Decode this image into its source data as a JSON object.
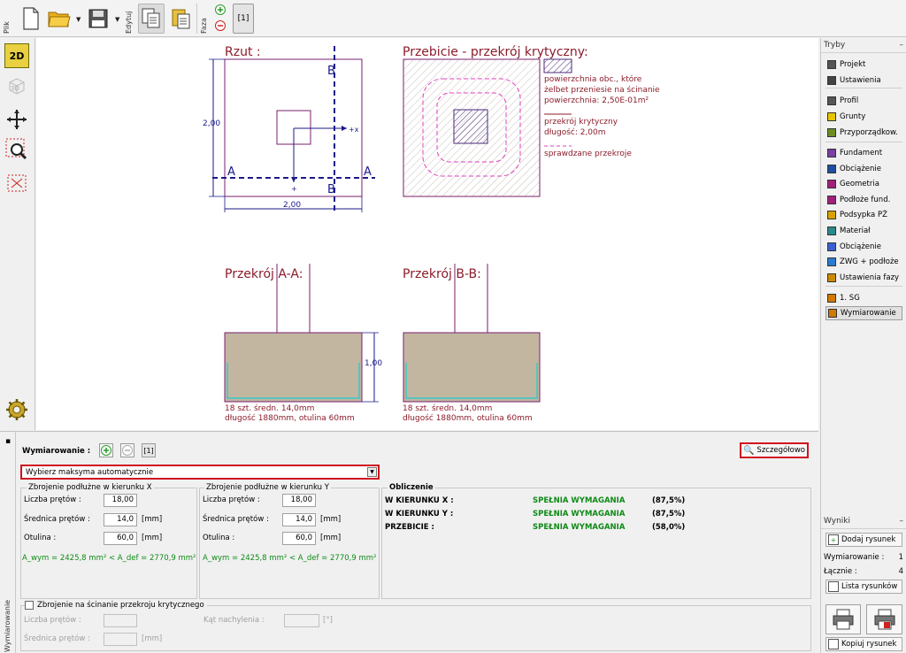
{
  "toolbar": {
    "plik_label": "Plik",
    "edytuj_label": "Edytuj",
    "faza_label": "Faza",
    "phase_tab": "[1]"
  },
  "lefttools": {
    "view2d": "2D",
    "view3d": "3D"
  },
  "drawing": {
    "rzut_title": "Rzut :",
    "dim_vertical": "2,00",
    "dim_horizontal": "2,00",
    "label_A": "A",
    "label_B": "B",
    "axis_x": "+x",
    "axis_plus": "+",
    "przebicie_title": "Przebicie - przekrój krytyczny:",
    "legend_1a": "powierzchnia obc., które",
    "legend_1b": "żelbet przeniesie na ścinanie",
    "legend_1c": "powierzchnia: 2,50E-01m²",
    "legend_2a": "przekrój krytyczny",
    "legend_2b": "długość: 2,00m",
    "legend_3": "sprawdzane przekroje",
    "section_aa_title": "Przekrój A-A:",
    "section_bb_title": "Przekrój B-B:",
    "dim_height": "1,00",
    "note_line1": "18 szt. średn. 14,0mm",
    "note_line2": "długość 1880mm, otulina 60mm"
  },
  "sidebar": {
    "tryby_title": "Tryby",
    "items": [
      {
        "label": "Projekt",
        "icon": "project-icon",
        "color": "#555555"
      },
      {
        "label": "Ustawienia",
        "icon": "settings-icon",
        "color": "#444444"
      },
      {
        "label": "Profil",
        "icon": "profile-icon",
        "color": "#555555"
      },
      {
        "label": "Grunty",
        "icon": "soil-icon",
        "color": "#e8c400"
      },
      {
        "label": "Przyporządkow.",
        "icon": "assign-icon",
        "color": "#6b8e23"
      },
      {
        "label": "Fundament",
        "icon": "foundation-icon",
        "color": "#7a3fa0"
      },
      {
        "label": "Obciążenie",
        "icon": "load-icon",
        "color": "#1f4fa0"
      },
      {
        "label": "Geometria",
        "icon": "geometry-icon",
        "color": "#a0207a"
      },
      {
        "label": "Podłoże fund.",
        "icon": "subsoil-icon",
        "color": "#a0207a"
      },
      {
        "label": "Podsypka PŻ",
        "icon": "sand-bed-icon",
        "color": "#d6a200"
      },
      {
        "label": "Materiał",
        "icon": "material-icon",
        "color": "#2b8a8a"
      },
      {
        "label": "Obciążenie",
        "icon": "load-case-icon",
        "color": "#3b5fd0"
      },
      {
        "label": "ZWG + podłoże",
        "icon": "water-table-icon",
        "color": "#2b7bd0"
      },
      {
        "label": "Ustawienia fazy",
        "icon": "phase-settings-icon",
        "color": "#cc8a00"
      },
      {
        "label": "1. SG",
        "icon": "sg-icon",
        "color": "#d07a00"
      },
      {
        "label": "Wymiarowanie",
        "icon": "dimensioning-icon",
        "color": "#d07a00"
      }
    ],
    "wyniki_title": "Wyniki",
    "add_drawing": "Dodaj rysunek",
    "wymiarowanie_label": "Wymiarowanie :",
    "wymiarowanie_count": "1",
    "lacznie_label": "Łącznie :",
    "lacznie_count": "4",
    "list_drawings": "Lista rysunków",
    "copy_drawing": "Kopiuj rysunek"
  },
  "bottom": {
    "vtab_label": "Wymiarowanie",
    "header_label": "Wymiarowanie :",
    "tab_1": "[1]",
    "details_button": "Szczegółowo",
    "select_value": "Wybierz maksyma automatycznie",
    "groupX": {
      "title": "Zbrojenie podłużne w kierunku X",
      "count_label": "Liczba prętów :",
      "count_value": "18,00",
      "dia_label": "Średnica prętów :",
      "dia_value": "14,0",
      "cover_label": "Otulina :",
      "cover_value": "60,0",
      "unit": "[mm]",
      "area_text": "A_wym = 2425,8 mm² < A_def = 2770,9 mm²"
    },
    "groupY": {
      "title": "Zbrojenie podłużne w kierunku Y",
      "count_label": "Liczba prętów :",
      "count_value": "18,00",
      "dia_label": "Średnica prętów :",
      "dia_value": "14,0",
      "cover_label": "Otulina :",
      "cover_value": "60,0",
      "unit": "[mm]",
      "area_text": "A_wym = 2425,8 mm² < A_def = 2770,9 mm²"
    },
    "obliczenie": {
      "title": "Obliczenie",
      "rows": [
        {
          "label": "W KIERUNKU X :",
          "status": "SPEŁNIA WYMAGANIA",
          "value": "(87,5%)"
        },
        {
          "label": "W KIERUNKU Y :",
          "status": "SPEŁNIA WYMAGANIA",
          "value": "(87,5%)"
        },
        {
          "label": "PRZEBICIE :",
          "status": "SPEŁNIA WYMAGANIA",
          "value": "(58,0%)"
        }
      ]
    },
    "shear": {
      "checkbox_label": "Zbrojenie na ścinanie przekroju krytycznego",
      "count_label": "Liczba prętów :",
      "dia_label": "Średnica prętów :",
      "unit": "[mm]",
      "angle_label": "Kąt nachylenia :",
      "angle_unit": "[°]"
    }
  }
}
